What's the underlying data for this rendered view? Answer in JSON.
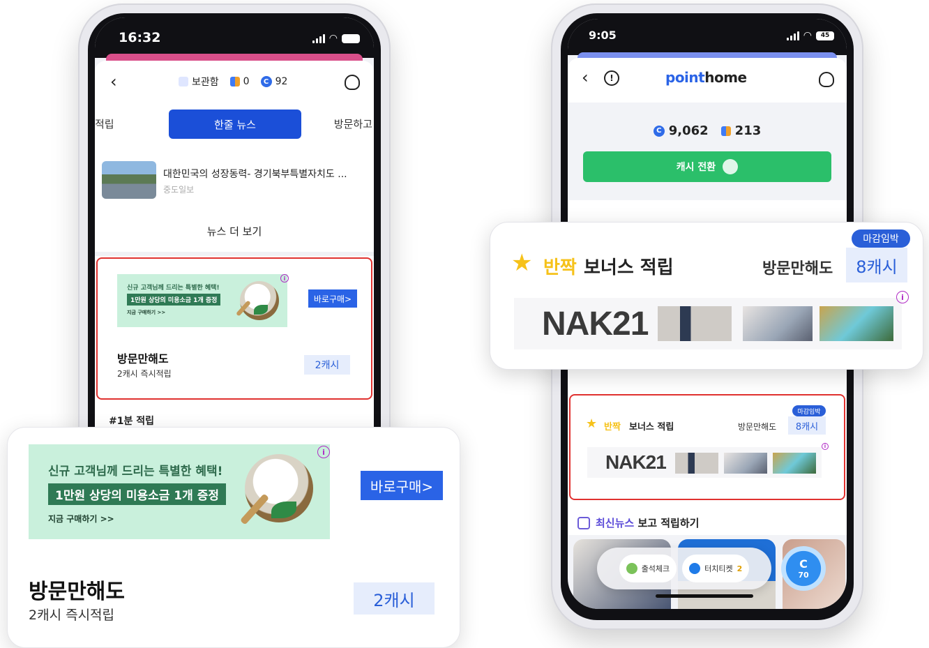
{
  "left_phone": {
    "status": {
      "time": "16:32"
    },
    "header": {
      "back_icon": "chevron-left-icon",
      "storage_label": "보관함",
      "coin_count": "0",
      "cash_count": "92",
      "support_icon": "headset-icon"
    },
    "tabs": {
      "left_partial": "적립",
      "active": "한줄 뉴스",
      "right_partial": "방문하고"
    },
    "news": {
      "title": "대한민국의 성장동력- 경기북부특별자치도 ...",
      "source": "중도일보",
      "more_label": "뉴스 더 보기"
    },
    "ad_card": {
      "ad_line1": "신규 고객님께 드리는 특별한 혜택!",
      "ad_line2": "1만원 상당의 미용소금 1개 증정",
      "ad_line3": "지금 구매하기 >>",
      "buy_button": "바로구매>",
      "visit_title": "방문만해도",
      "visit_sub": "2캐시 즉시적립",
      "reward": "2캐시"
    },
    "section_label": "#1분 적립"
  },
  "left_zoom": {
    "ad_line1": "신규 고객님께 드리는 특별한 혜택!",
    "ad_line2": "1만원 상당의 미용소금 1개 증정",
    "ad_line3": "지금 구매하기 >>",
    "buy_button": "바로구매>",
    "visit_title": "방문만해도",
    "visit_sub": "2캐시 즉시적립",
    "reward": "2캐시"
  },
  "right_phone": {
    "status": {
      "time": "9:05",
      "battery": "45"
    },
    "header": {
      "logo_point": "point",
      "logo_home": "home"
    },
    "points": {
      "cash": "9,062",
      "coins": "213"
    },
    "convert_button": "캐시 전환",
    "bonus_card": {
      "bang": "반짝",
      "title": "보너스 적립",
      "visit_label": "방문만해도",
      "reward": "8캐시",
      "deadline_badge": "마감임박",
      "brand": "NAK21"
    },
    "latest_news": {
      "highlight": "최신뉴스",
      "rest": "보고 적립하기"
    },
    "floating": {
      "checkin": "출석체크",
      "ticket": "터치티켓",
      "ticket_count": "2",
      "cash_badge_letter": "C",
      "cash_badge_value": "70"
    }
  },
  "right_zoom": {
    "bang": "반짝",
    "title": "보너스 적립",
    "visit_label": "방문만해도",
    "reward": "8캐시",
    "deadline_badge": "마감임박",
    "brand": "NAK21"
  },
  "colors": {
    "primary_blue": "#1b4fd8",
    "convert_green": "#2bbf6a",
    "highlight_red": "#e0312f",
    "ad_mint": "#c9f0dc",
    "star_yellow": "#f6c21a"
  }
}
